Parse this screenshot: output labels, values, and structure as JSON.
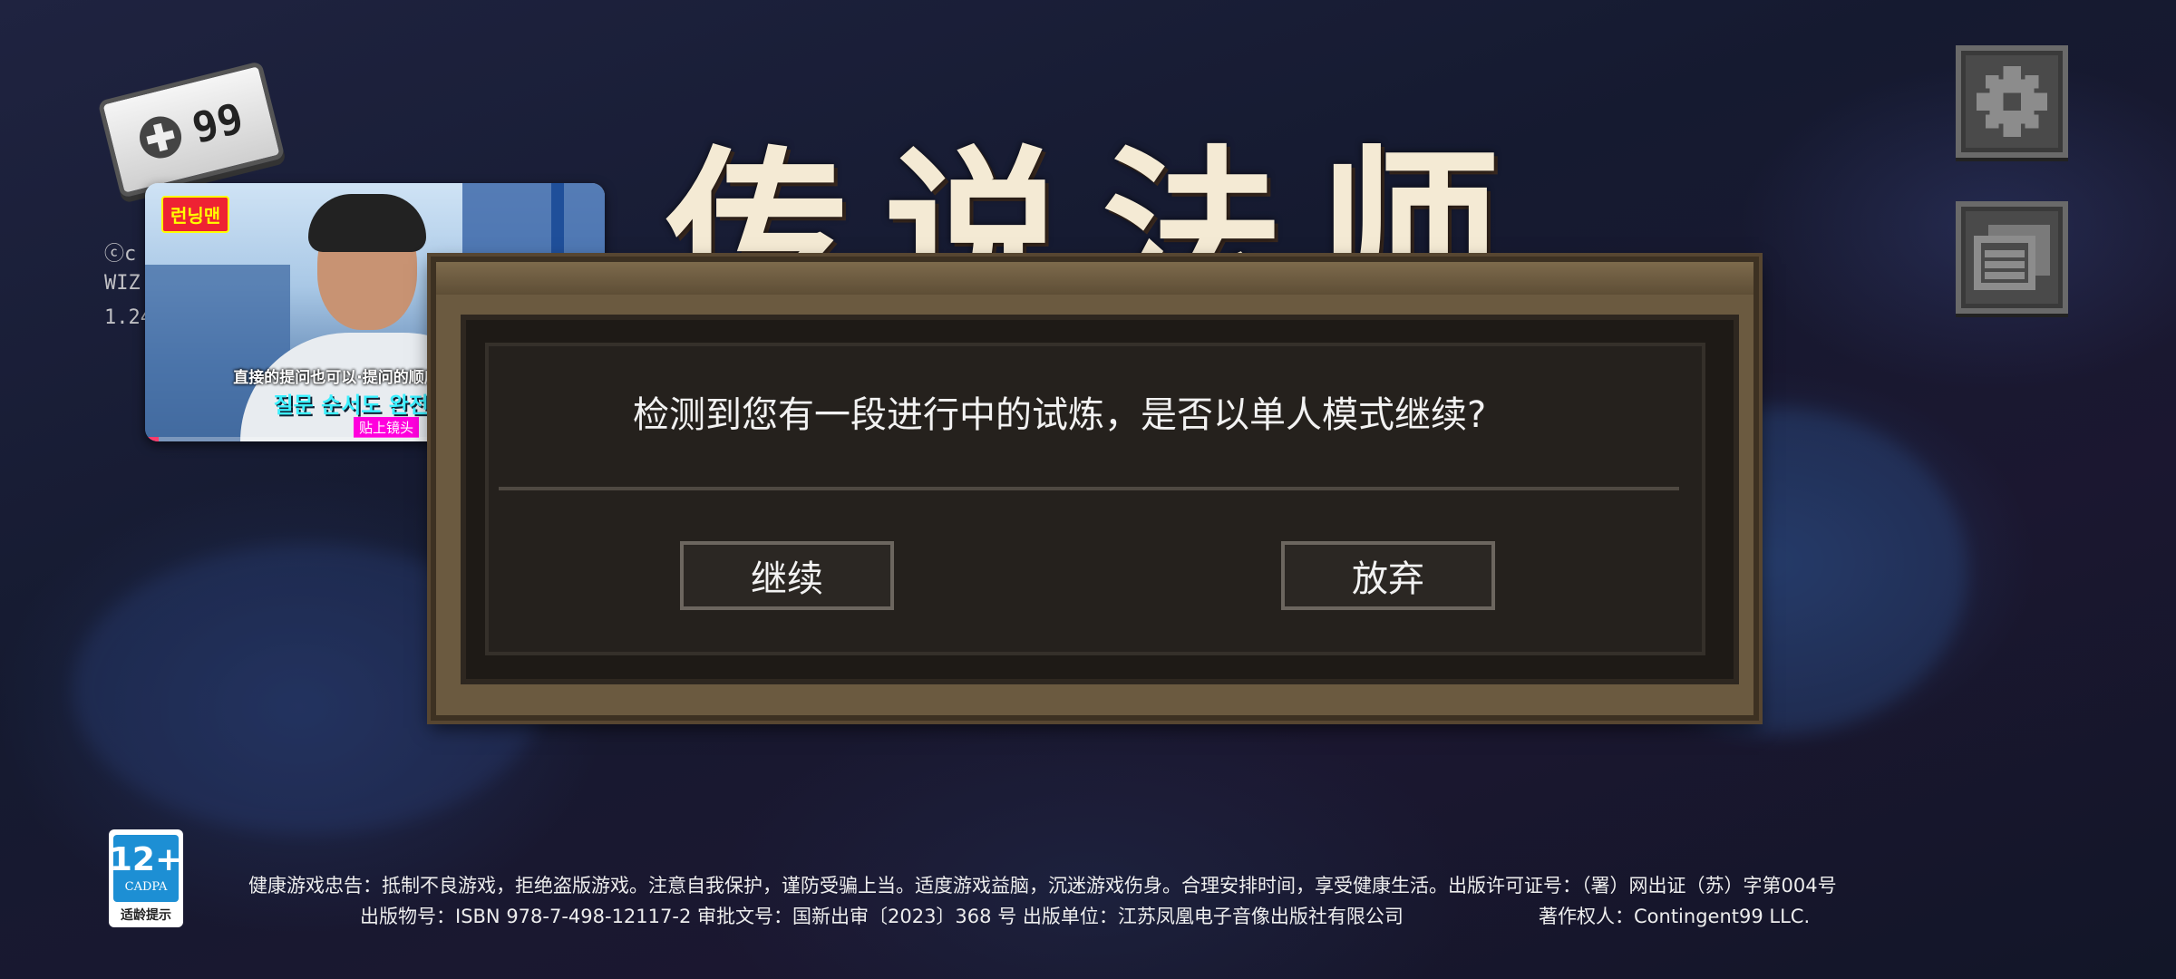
{
  "title": {
    "text": "传说法师"
  },
  "controller_badge": {
    "count": "99"
  },
  "side_text": [
    "ⓒc",
    "WIZ",
    "1.24"
  ],
  "video": {
    "show_logo": "런닝맨",
    "subtitle_cn": "直接的提问也可以·提问的顺序也完全自由",
    "subtitle_kr": "질문 순서도 완전 자유",
    "tag": "贴上镜头",
    "progress": 0.03
  },
  "dialog": {
    "message": "检测到您有一段进行中的试炼，是否以单人模式继续?",
    "continue_label": "继续",
    "abandon_label": "放弃"
  },
  "age_rating": {
    "age": "12+",
    "org": "CADPA",
    "tip": "适龄提示"
  },
  "footer": {
    "line1": "健康游戏忠告：抵制不良游戏，拒绝盗版游戏。注意自我保护，谨防受骗上当。适度游戏益脑，沉迷游戏伤身。合理安排时间，享受健康生活。出版许可证号：（署）网出证（苏）字第004号",
    "line2": "出版物号：ISBN 978-7-498-12117-2  审批文号：国新出审〔2023〕368 号  出版单位：江苏凤凰电子音像出版社有限公司",
    "copyright": "著作权人：Contingent99 LLC."
  },
  "colors": {
    "dialog_bg": "#25211d",
    "frame": "#6b5a40",
    "button_border": "#6c665f",
    "age_badge": "#1d8fd4"
  },
  "icons": [
    "gamepad-icon",
    "gear-icon",
    "log-icon"
  ]
}
